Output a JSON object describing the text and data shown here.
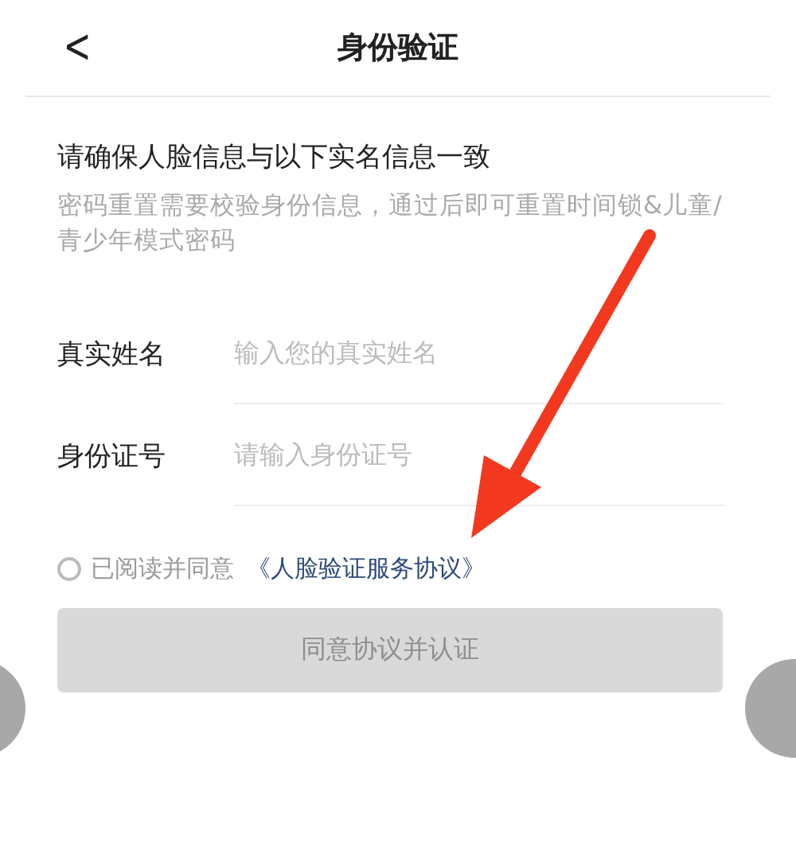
{
  "header": {
    "back": "<",
    "title": "身份验证"
  },
  "heading": "请确保人脸信息与以下实名信息一致",
  "note": "密码重置需要校验身份信息，通过后即可重置时间锁&儿童/青少年模式密码",
  "fields": [
    {
      "label": "真实姓名",
      "placeholder": "输入您的真实姓名"
    },
    {
      "label": "身份证号",
      "placeholder": "请输入身份证号"
    }
  ],
  "agreement": {
    "checked": false,
    "text": "已阅读并同意",
    "link": "《人脸验证服务协议》"
  },
  "submit": {
    "label": "同意协议并认证",
    "disabled": true
  }
}
